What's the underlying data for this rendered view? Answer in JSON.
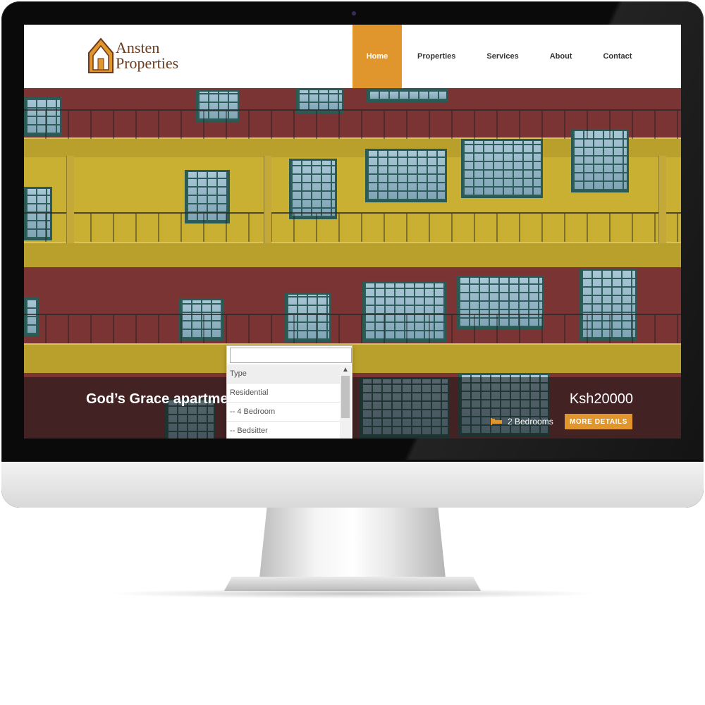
{
  "brand": {
    "line1": "Ansten",
    "line2": "Properties",
    "accent_color": "#e0962c",
    "text_color": "#6b3a1c",
    "logo_icon": "house-logo-icon"
  },
  "nav": {
    "items": [
      {
        "label": "Home",
        "active": true
      },
      {
        "label": "Properties",
        "active": false
      },
      {
        "label": "Services",
        "active": false
      },
      {
        "label": "About",
        "active": false
      },
      {
        "label": "Contact",
        "active": false
      }
    ]
  },
  "hero": {
    "title": "God’s Grace apartme",
    "price": "Ksh20000",
    "bedrooms": "2 Bedrooms",
    "bed_icon": "bed-icon",
    "details_button": "MORE DETAILS"
  },
  "dropdown": {
    "search_value": "",
    "options": [
      "Type",
      "Residential",
      "-- 4 Bedroom",
      "-- Bedsitter"
    ],
    "scroll_icon": "chevron-up-icon"
  }
}
